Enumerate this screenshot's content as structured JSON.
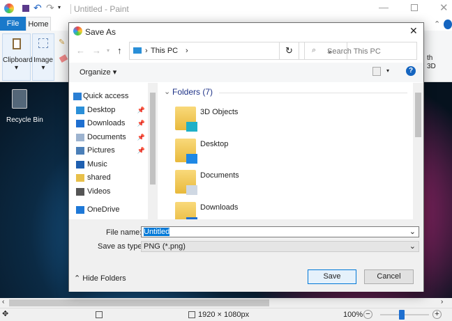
{
  "paint": {
    "title": "Untitled - Paint",
    "tabs": {
      "file": "File",
      "home": "Home"
    },
    "groups": {
      "clipboard": "Clipboard",
      "image": "Image"
    },
    "right_fragment": "th\n3D",
    "recycle_bin": "Recycle Bin",
    "status": {
      "dimensions": "1920 × 1080px",
      "zoom": "100%"
    },
    "zoom_fraction": 0.5
  },
  "dialog": {
    "title": "Save As",
    "address": {
      "location": "This PC"
    },
    "search_placeholder": "Search This PC",
    "organize": "Organize",
    "nav": [
      {
        "label": "Quick access",
        "icon": "star-icon"
      },
      {
        "label": "Desktop",
        "icon": "desktop-icon",
        "pinned": true
      },
      {
        "label": "Downloads",
        "icon": "download-icon",
        "pinned": true
      },
      {
        "label": "Documents",
        "icon": "document-icon",
        "pinned": true
      },
      {
        "label": "Pictures",
        "icon": "pictures-icon",
        "pinned": true
      },
      {
        "label": "Music",
        "icon": "music-icon"
      },
      {
        "label": "shared",
        "icon": "folder-icon"
      },
      {
        "label": "Videos",
        "icon": "video-icon"
      },
      {
        "label": "OneDrive",
        "icon": "cloud-icon"
      }
    ],
    "group_header": "Folders (7)",
    "folders": [
      "3D Objects",
      "Desktop",
      "Documents",
      "Downloads"
    ],
    "file_name_label": "File name:",
    "file_name": "Untitled",
    "type_label": "Save as type:",
    "type_value": "PNG (*.png)",
    "hide_folders": "Hide Folders",
    "save": "Save",
    "cancel": "Cancel"
  }
}
